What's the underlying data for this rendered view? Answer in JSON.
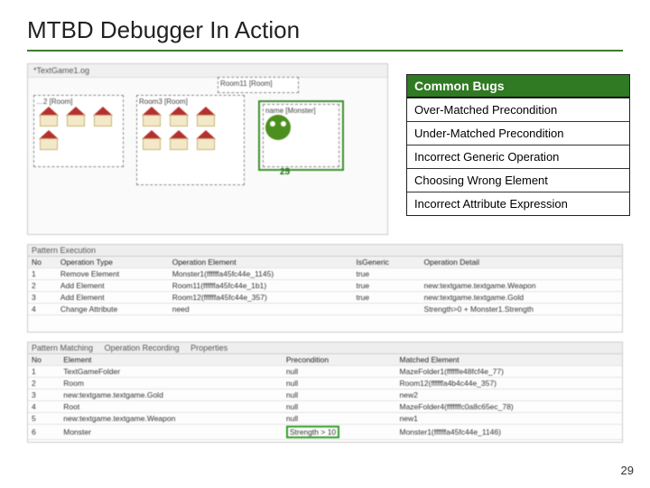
{
  "title": "MTBD Debugger In Action",
  "page_number": "29",
  "bugs": {
    "header": "Common Bugs",
    "items": [
      "Over-Matched Precondition",
      "Under-Matched Precondition",
      "Incorrect Generic Operation",
      "Choosing Wrong Element",
      "Incorrect Attribute Expression"
    ]
  },
  "diagram": {
    "tab": "*TextGame1.og",
    "room_a": "Room3 [Room]",
    "room_b": "Room11 [Room]",
    "monster_label": "name [Monster]",
    "annotation_number": "25"
  },
  "pattern_exec": {
    "tab": "Pattern Execution",
    "columns": [
      "No",
      "Operation Type",
      "Operation Element",
      "IsGeneric",
      "Operation Detail"
    ],
    "rows": [
      [
        "1",
        "Remove Element",
        "Monster1(ffffffa45fc44e_1145)",
        "true",
        ""
      ],
      [
        "2",
        "Add Element",
        "Room11(ffffffa45fc44e_1b1)",
        "true",
        "new:textgame.textgame.Weapon"
      ],
      [
        "3",
        "Add Element",
        "Room12(ffffffa45fc44e_357)",
        "true",
        "new:textgame.textgame.Gold"
      ],
      [
        "4",
        "Change Attribute",
        "need",
        "",
        "Strength>0 + Monster1.Strength"
      ]
    ]
  },
  "pattern_matching": {
    "tabs": [
      "Pattern Matching",
      "Operation Recording",
      "Properties"
    ],
    "columns": [
      "No",
      "Element",
      "Precondition",
      "Matched Element"
    ],
    "rows": [
      [
        "1",
        "TextGameFolder",
        "null",
        "MazeFolder1(ffffffe48fcf4e_77)"
      ],
      [
        "2",
        "Room",
        "null",
        "Room12(ffffffa4b4c44e_357)"
      ],
      [
        "3",
        "new:textgame.textgame.Gold",
        "null",
        "new2"
      ],
      [
        "4",
        "Root",
        "null",
        "MazeFolder4(fffffffc0a8c65ec_78)"
      ],
      [
        "5",
        "new:textgame.textgame.Weapon",
        "null",
        "new1"
      ],
      [
        "6",
        "Monster",
        "Strength > 10",
        "Monster1(ffffffa45fc44e_1146)"
      ]
    ]
  }
}
